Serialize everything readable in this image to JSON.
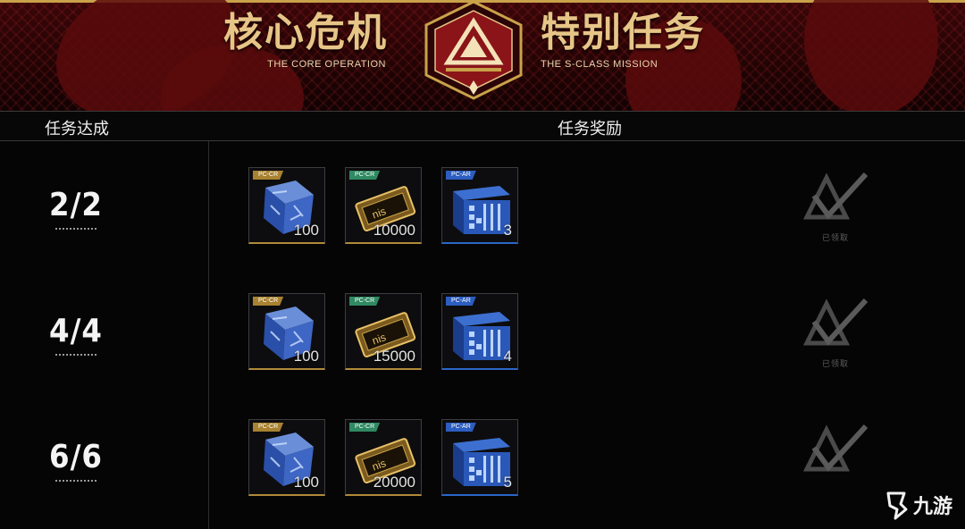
{
  "banner": {
    "title_left_cn": "核心危机",
    "title_left_en": "THE CORE OPERATION",
    "title_right_cn": "特别任务",
    "title_right_en": "THE S-CLASS MISSION",
    "emblem_icon": "s-class-triangle-emblem-icon"
  },
  "header": {
    "condition_label": "任务达成",
    "reward_label": "任务奖励"
  },
  "rows": [
    {
      "progress": "2/2",
      "rewards": [
        {
          "tag": "PC-CR",
          "quantity": "100",
          "icon": "blue-crystal-cube-icon",
          "tier_color": "#a88230"
        },
        {
          "tag": "PC-CR",
          "quantity": "10000",
          "icon": "gold-card-icon",
          "tier_color": "#2f8a62"
        },
        {
          "tag": "PC-AR",
          "quantity": "3",
          "icon": "blue-supply-crate-icon",
          "tier_color": "#2c5dc0"
        }
      ],
      "status": "已领取",
      "status_icon": "claimed-checkmark-icon"
    },
    {
      "progress": "4/4",
      "rewards": [
        {
          "tag": "PC-CR",
          "quantity": "100",
          "icon": "blue-crystal-cube-icon",
          "tier_color": "#a88230"
        },
        {
          "tag": "PC-CR",
          "quantity": "15000",
          "icon": "gold-card-icon",
          "tier_color": "#2f8a62"
        },
        {
          "tag": "PC-AR",
          "quantity": "4",
          "icon": "blue-supply-crate-icon",
          "tier_color": "#2c5dc0"
        }
      ],
      "status": "已领取",
      "status_icon": "claimed-checkmark-icon"
    },
    {
      "progress": "6/6",
      "rewards": [
        {
          "tag": "PC-CR",
          "quantity": "100",
          "icon": "blue-crystal-cube-icon",
          "tier_color": "#a88230"
        },
        {
          "tag": "PC-CR",
          "quantity": "20000",
          "icon": "gold-card-icon",
          "tier_color": "#2f8a62"
        },
        {
          "tag": "PC-AR",
          "quantity": "5",
          "icon": "blue-supply-crate-icon",
          "tier_color": "#2c5dc0"
        }
      ],
      "status": "",
      "status_icon": "claimed-checkmark-icon"
    }
  ],
  "watermark": {
    "text": "九游",
    "icon": "jiuyou-logo-icon"
  },
  "colors": {
    "accent_gold": "#e6c587",
    "banner_red": "#3a0608",
    "background": "#050505"
  }
}
